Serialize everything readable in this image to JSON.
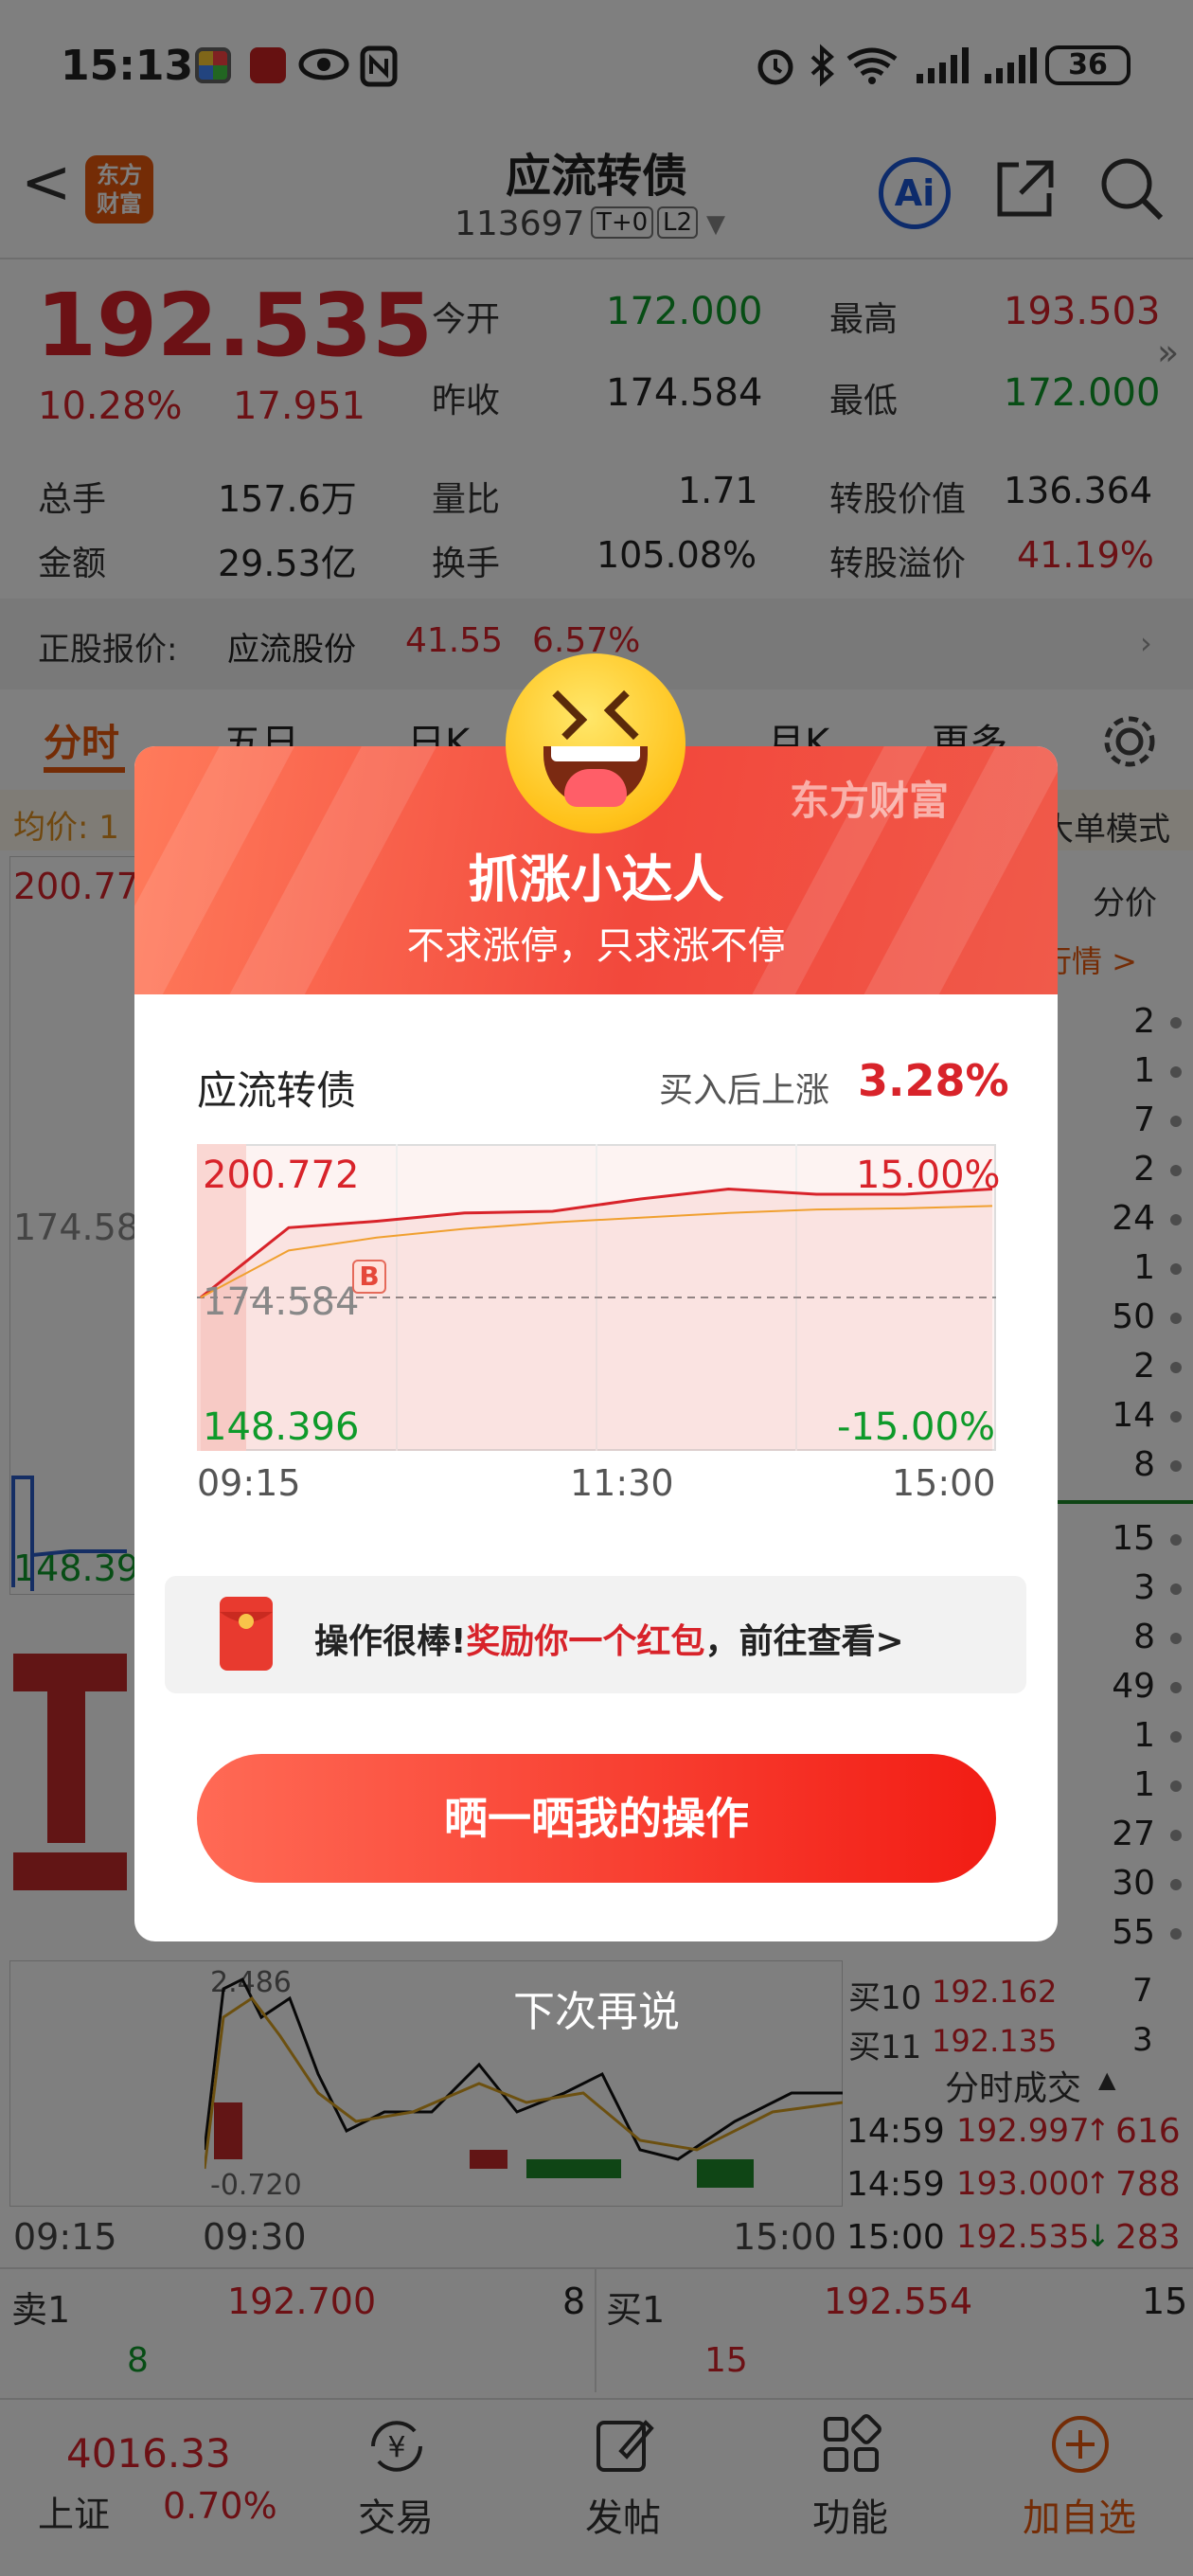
{
  "status_bar": {
    "time": "15:13",
    "battery": "36"
  },
  "header": {
    "back": "<",
    "logo": "东方\n财富",
    "title": "应流转债",
    "code": "113697",
    "badge_t0": "T+0",
    "badge_l2": "L2",
    "ai": "Ai"
  },
  "quote": {
    "price": "192.535",
    "change_pct": "10.28%",
    "change_amt": "17.951",
    "open_label": "今开",
    "open": "172.000",
    "high_label": "最高",
    "high": "193.503",
    "prev_label": "昨收",
    "prev": "174.584",
    "low_label": "最低",
    "low": "172.000",
    "vol_label": "总手",
    "vol": "157.6万",
    "vr_label": "量比",
    "vr": "1.71",
    "cv_label": "转股价值",
    "cv": "136.364",
    "amt_label": "金额",
    "amt": "29.53亿",
    "turn_label": "换手",
    "turn": "105.08%",
    "prem_label": "转股溢价",
    "prem": "41.19%",
    "stock_label": "正股报价:",
    "stock_name": "应流股份",
    "stock_price": "41.55",
    "stock_pct": "6.57%"
  },
  "tabs": {
    "t1": "分时",
    "t2": "五日",
    "t3": "日K",
    "t4": "月K",
    "t5": "更多",
    "avg": "均价: 1",
    "big_order": "大单模式",
    "fenjia": "分价",
    "quote_link": "行情 >"
  },
  "left_chart": {
    "top": "200.77",
    "mid": "174.58",
    "bottom": "148.39",
    "macd_top": "2.486",
    "macd_bottom": "-0.720",
    "t_start": "09:15",
    "t_open": "09:30",
    "t_end": "15:00"
  },
  "right_list": [
    "2",
    "1",
    "7",
    "2",
    "24",
    "1",
    "50",
    "2",
    "14",
    "8",
    "15",
    "3",
    "8",
    "49",
    "1",
    "1",
    "27",
    "30",
    "55",
    "7",
    "3"
  ],
  "buy_rows": [
    {
      "label": "买10",
      "price": "192.162",
      "vol": "7"
    },
    {
      "label": "买11",
      "price": "192.135",
      "vol": "3"
    }
  ],
  "trades_title": "分时成交",
  "trades": [
    {
      "time": "14:59",
      "price": "192.997",
      "arrow": "↑",
      "vol": "616"
    },
    {
      "time": "14:59",
      "price": "193.000",
      "arrow": "↑",
      "vol": "788"
    },
    {
      "time": "15:00",
      "price": "192.535",
      "arrow": "↓",
      "vol": "283"
    }
  ],
  "book": {
    "sell1_label": "卖1",
    "sell1_price": "192.700",
    "sell1_vol": "8",
    "buy1_label": "买1",
    "buy1_price": "192.554",
    "buy1_vol": "15",
    "sell_extra": "8",
    "buy_extra": "15"
  },
  "bottom_nav": {
    "index_value": "4016.33",
    "index_name": "上证",
    "index_pct": "0.70%",
    "trade": "交易",
    "post": "发帖",
    "func": "功能",
    "add": "加自选"
  },
  "modal": {
    "brand": "东方财富",
    "title": "抓涨小达人",
    "subtitle": "不求涨停，只求涨不停",
    "bond_name": "应流转债",
    "gain_label": "买入后上涨",
    "gain_value": "3.28%",
    "y_top": "200.772",
    "y_mid": "174.584",
    "y_bottom": "148.396",
    "pct_top": "15.00%",
    "pct_bottom": "-15.00%",
    "t_start": "09:15",
    "t_mid": "11:30",
    "t_end": "15:00",
    "buy_marker": "B",
    "reward_pre": "操作很棒!",
    "reward_red": "奖励你一个红包",
    "reward_post": "，前往查看>",
    "share_button": "晒一晒我的操作",
    "dismiss": "下次再说"
  },
  "chart_data": {
    "type": "line",
    "x": [
      "09:15",
      "09:30",
      "10:00",
      "10:30",
      "11:00",
      "11:30",
      "13:30",
      "14:00",
      "14:30",
      "15:00"
    ],
    "series": [
      {
        "values": [
          174.584,
          186.5,
          187.6,
          189.0,
          189.3,
          191.4,
          193.1,
          192.2,
          192.2,
          193.1
        ]
      },
      {
        "values": [
          174.584,
          182.6,
          184.8,
          186.3,
          187.4,
          188.2,
          189.0,
          189.6,
          189.8,
          190.2
        ]
      }
    ],
    "ylim": [
      148.396,
      200.772
    ],
    "colors": {
      "price": "#d8232a",
      "avg": "#f0a030"
    }
  }
}
